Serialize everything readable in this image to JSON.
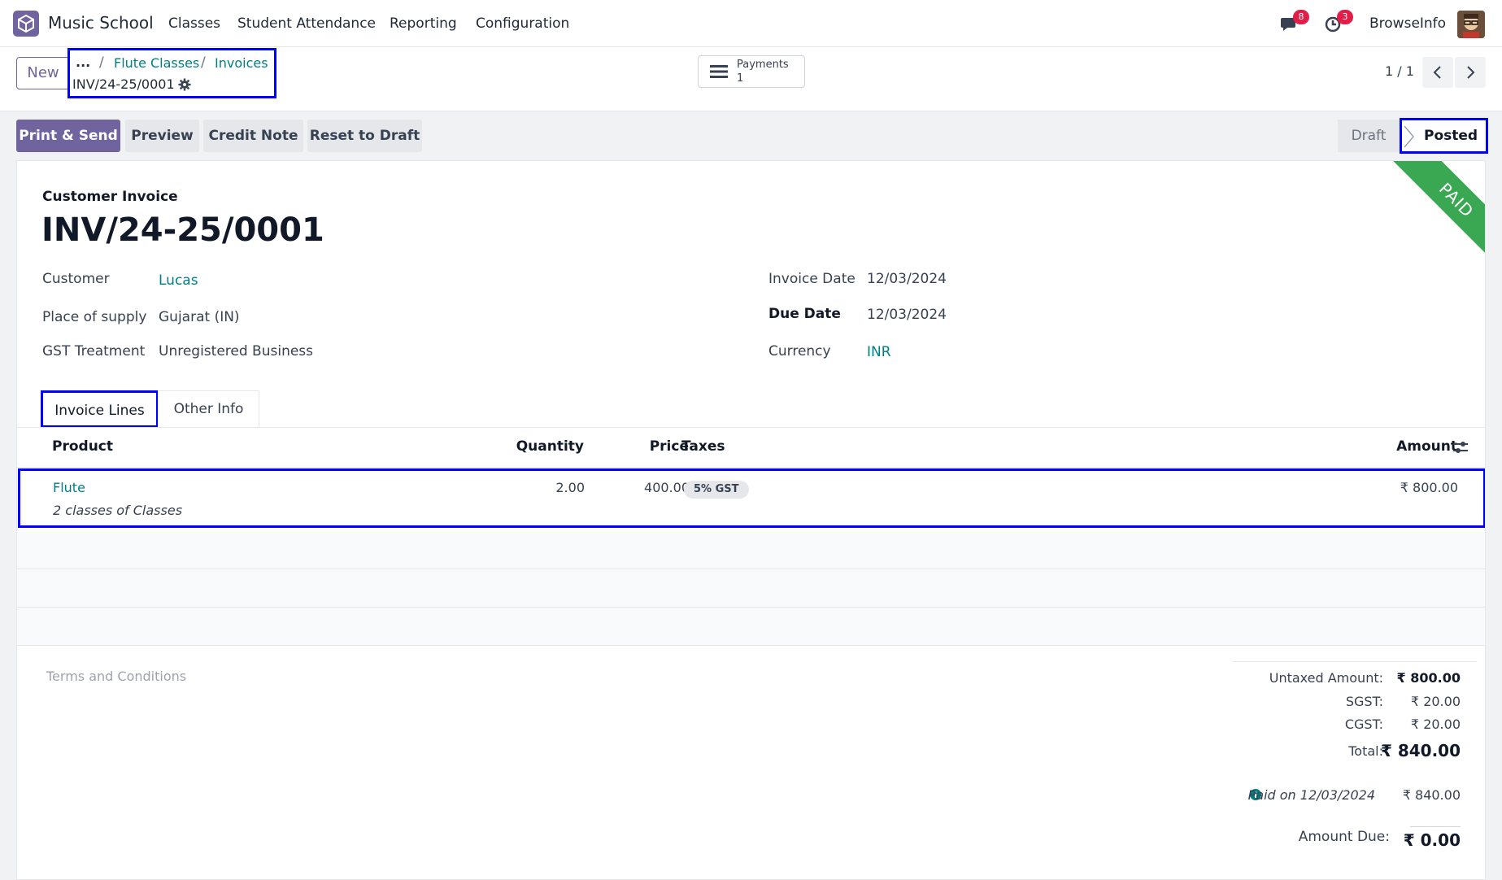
{
  "navbar": {
    "app_name": "Music School",
    "menu": [
      "Classes",
      "Student Attendance",
      "Reporting",
      "Configuration"
    ],
    "messages_count": "8",
    "activities_count": "3",
    "user_name": "BrowseInfo",
    "icons": {
      "app": "music-school-logo-icon",
      "messages": "chat-icon",
      "activities": "clock-icon"
    }
  },
  "control": {
    "new_label": "New",
    "breadcrumb": {
      "dots": "...",
      "items": [
        "Flute Classes",
        "Invoices"
      ],
      "separator": "/"
    },
    "record_name": "INV/24-25/0001",
    "smart_button": {
      "label": "Payments",
      "value": "1"
    },
    "pager": "1 / 1"
  },
  "actions": {
    "buttons": [
      "Print & Send",
      "Preview",
      "Credit Note",
      "Reset to Draft"
    ],
    "status": [
      "Draft",
      "Posted"
    ],
    "current_status": "Posted"
  },
  "invoice": {
    "ribbon": "PAID",
    "doc_type": "Customer Invoice",
    "name": "INV/24-25/0001",
    "left_fields": [
      {
        "label": "Customer",
        "value": "Lucas"
      },
      {
        "label": "Place of supply",
        "value": "Gujarat (IN)"
      },
      {
        "label": "GST Treatment",
        "value": "Unregistered Business"
      }
    ],
    "right_fields": [
      {
        "label": "Invoice Date",
        "value": "12/03/2024"
      },
      {
        "label": "Due Date",
        "value": "12/03/2024"
      },
      {
        "label": "Currency",
        "value": "INR"
      }
    ],
    "tabs": [
      "Invoice Lines",
      "Other Info"
    ],
    "columns": [
      "Product",
      "Quantity",
      "Price",
      "Taxes",
      "Amount"
    ],
    "lines": [
      {
        "product": "Flute",
        "description": "2 classes of  Classes",
        "quantity": "2.00",
        "price": "400.00",
        "tax": "5% GST",
        "amount": "₹ 800.00"
      }
    ],
    "terms_placeholder": "Terms and Conditions",
    "totals": {
      "untaxed_label": "Untaxed Amount:",
      "untaxed_value": "₹ 800.00",
      "sgst_label": "SGST:",
      "sgst_value": "₹ 20.00",
      "cgst_label": "CGST:",
      "cgst_value": "₹ 20.00",
      "total_label": "Total:",
      "total_value": "₹ 840.00",
      "paid_label": "Paid on 12/03/2024",
      "paid_value": "₹ 840.00",
      "due_label": "Amount Due:",
      "due_value": "₹ 0.00"
    }
  },
  "colors": {
    "brand": "#71639e",
    "link": "#017e84",
    "ribbon": "#3aa853",
    "highlight": "#0000ff",
    "badge": "#e11d48"
  }
}
